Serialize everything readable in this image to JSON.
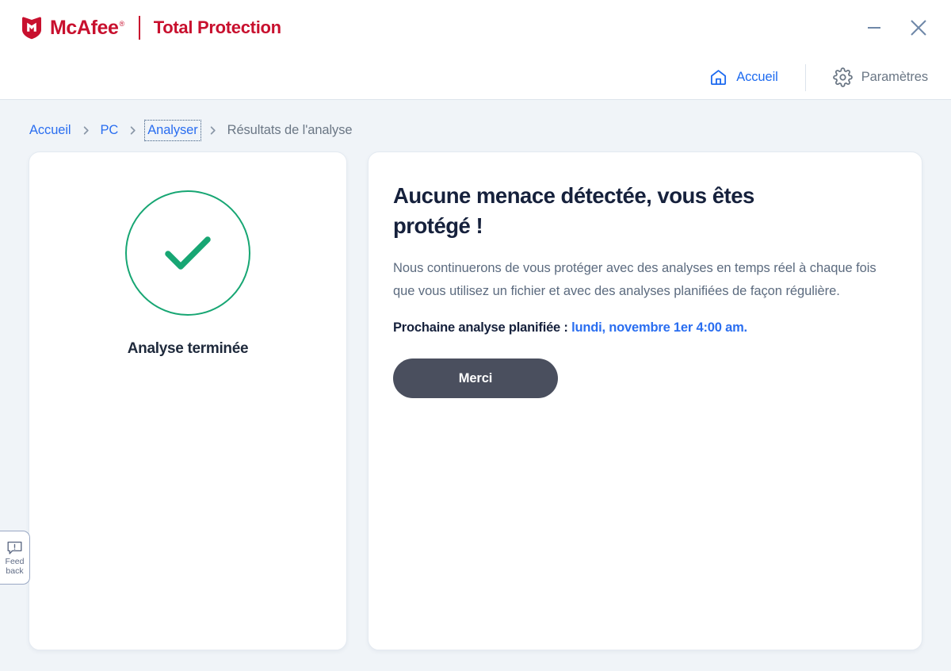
{
  "app": {
    "brand_name": "McAfee",
    "brand_tm": "®",
    "product_name": "Total Protection",
    "brand_color": "#c8102e"
  },
  "window_controls": {
    "minimize": "minimize-icon",
    "close": "close-icon"
  },
  "nav": {
    "home_label": "Accueil",
    "home_icon": "home-icon",
    "settings_label": "Paramètres",
    "settings_icon": "gear-icon",
    "home_color": "#1e6bf0",
    "settings_color": "#6b7785"
  },
  "breadcrumb": {
    "separator_icon": "chevron-right-icon",
    "items": [
      {
        "label": "Accueil",
        "current": false,
        "focused": false
      },
      {
        "label": "PC",
        "current": false,
        "focused": false
      },
      {
        "label": "Analyser",
        "current": false,
        "focused": true
      },
      {
        "label": "Résultats de l'analyse",
        "current": true,
        "focused": false
      }
    ]
  },
  "scan_status": {
    "icon": "check-circle-icon",
    "label": "Analyse terminée",
    "accent_color": "#17a673"
  },
  "result": {
    "title": "Aucune menace détectée, vous êtes protégé !",
    "body": "Nous continuerons de vous protéger avec des analyses en temps réel à chaque fois que vous utilisez un fichier et avec des analyses planifiées de façon régulière.",
    "schedule_label": "Prochaine analyse planifiée :",
    "schedule_value": "lundi, novembre 1er 4:00 am.",
    "schedule_value_color": "#2a6ef0",
    "button_label": "Merci",
    "button_color": "#4a4f5e"
  },
  "feedback": {
    "icon": "feedback-bubble-icon",
    "line1": "Feed",
    "line2": "back"
  }
}
